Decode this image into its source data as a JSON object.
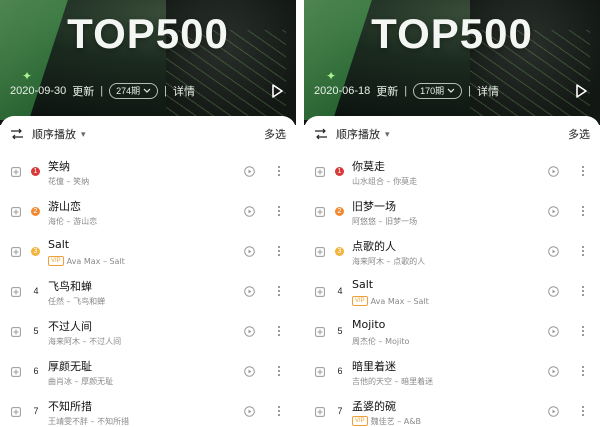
{
  "colors": {
    "rank1": "#d83a3a",
    "rank2": "#f08b35",
    "rank3": "#f2b33a",
    "vip_accent": "#f0a13a"
  },
  "panels": [
    {
      "header": {
        "title": "TOP500",
        "date": "2020-09-30",
        "update_label": "更新",
        "issue_pill": "274期",
        "detail_label": "详情"
      },
      "toolbar": {
        "order_label": "顺序播放",
        "multiselect_label": "多选"
      },
      "songs": [
        {
          "rank": "1",
          "title": "笑纳",
          "artist_line": "花僮 – 笑纳",
          "vip": ""
        },
        {
          "rank": "2",
          "title": "游山恋",
          "artist_line": "海伦 – 游山恋",
          "vip": ""
        },
        {
          "rank": "3",
          "title": "Salt",
          "artist_line": "Ava Max – Salt",
          "vip": "VIP"
        },
        {
          "rank": "4",
          "title": "飞鸟和蝉",
          "artist_line": "任然 – 飞鸟和蝉",
          "vip": ""
        },
        {
          "rank": "5",
          "title": "不过人间",
          "artist_line": "海来阿木 – 不过人间",
          "vip": ""
        },
        {
          "rank": "6",
          "title": "厚颜无耻",
          "artist_line": "曲肖冰 – 厚颜无耻",
          "vip": ""
        },
        {
          "rank": "7",
          "title": "不知所措",
          "artist_line": "王靖雯不胖 – 不知所措",
          "vip": ""
        }
      ]
    },
    {
      "header": {
        "title": "TOP500",
        "date": "2020-06-18",
        "update_label": "更新",
        "issue_pill": "170期",
        "detail_label": "详情"
      },
      "toolbar": {
        "order_label": "顺序播放",
        "multiselect_label": "多选"
      },
      "songs": [
        {
          "rank": "1",
          "title": "你莫走",
          "artist_line": "山水组合 – 你莫走",
          "vip": ""
        },
        {
          "rank": "2",
          "title": "旧梦一场",
          "artist_line": "阿悠悠 – 旧梦一场",
          "vip": ""
        },
        {
          "rank": "3",
          "title": "点歌的人",
          "artist_line": "海来阿木 – 点歌的人",
          "vip": ""
        },
        {
          "rank": "4",
          "title": "Salt",
          "artist_line": "Ava Max – Salt",
          "vip": "VIP"
        },
        {
          "rank": "5",
          "title": "Mojito",
          "artist_line": "周杰伦 – Mojito",
          "vip": ""
        },
        {
          "rank": "6",
          "title": "暗里着迷",
          "artist_line": "吉他的天空 – 暗里着迷",
          "vip": ""
        },
        {
          "rank": "7",
          "title": "孟婆的碗",
          "artist_line": "魏佳艺 – A&B",
          "vip": "VIP"
        }
      ]
    }
  ]
}
